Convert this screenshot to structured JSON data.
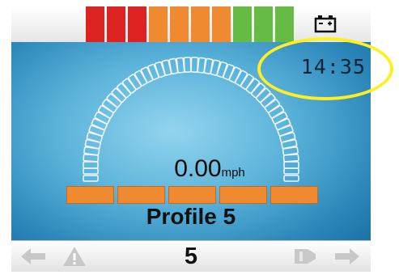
{
  "battery": {
    "segment_colors": [
      "#dd2222",
      "#dd2222",
      "#dd2222",
      "#ef8a30",
      "#ef8a30",
      "#ef8a30",
      "#ef8a30",
      "#66bb44",
      "#66bb44",
      "#66bb44"
    ],
    "icon": "battery-icon"
  },
  "clock": {
    "time": "14:35"
  },
  "speed": {
    "value": "0.00",
    "unit": "mph"
  },
  "speed_bars": {
    "count": 5,
    "color": "#ef8a30"
  },
  "profile": {
    "name": "Profile 5",
    "number": "5"
  },
  "navigation": {
    "left_arrow_icon": "arrow-left-icon",
    "warning_icon": "warning-triangle-icon",
    "horn_icon": "horn-icon",
    "right_arrow_icon": "arrow-right-icon"
  },
  "highlight": {
    "color": "#ffee22"
  }
}
